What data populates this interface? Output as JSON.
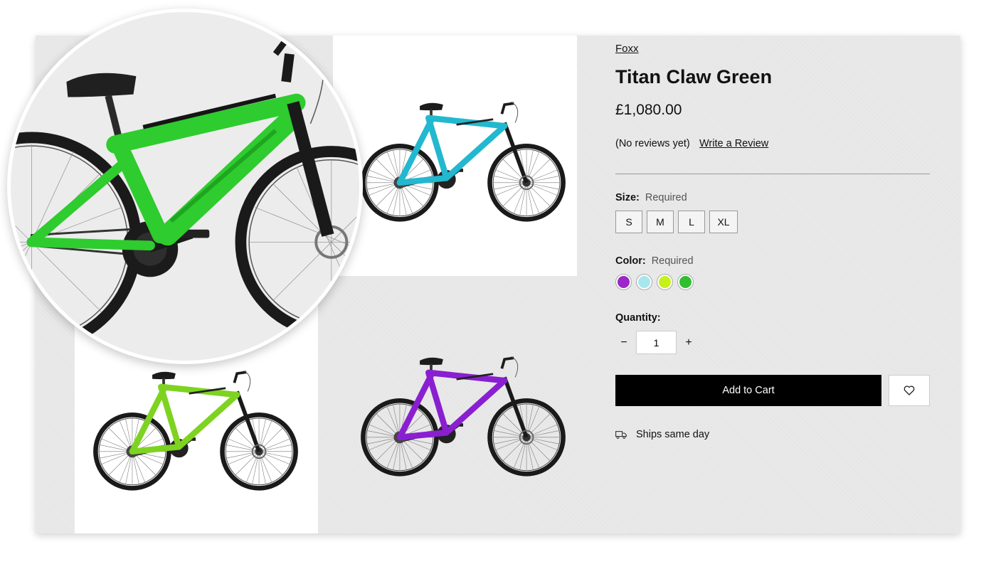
{
  "product": {
    "brand": "Foxx",
    "title": "Titan Claw Green",
    "price": "£1,080.00",
    "reviews_text": "(No reviews yet)",
    "write_review_label": "Write a Review"
  },
  "gallery": {
    "colors": {
      "zoom_frame": "#2ecc2e",
      "teal": "#22b8cf",
      "lime": "#7ed321",
      "purple": "#8a1fd1"
    }
  },
  "options": {
    "size": {
      "label": "Size:",
      "required": "Required",
      "values": [
        "S",
        "M",
        "L",
        "XL"
      ]
    },
    "color": {
      "label": "Color:",
      "required": "Required",
      "swatches": [
        "#9b27c9",
        "#a8e6ee",
        "#c6f01a",
        "#2fbf2f"
      ]
    },
    "quantity": {
      "label": "Quantity:",
      "value": "1",
      "decrement": "−",
      "increment": "+"
    }
  },
  "actions": {
    "add_to_cart": "Add to Cart",
    "wishlist_icon": "heart-icon"
  },
  "shipping": {
    "text": "Ships same day",
    "icon": "truck-icon"
  }
}
